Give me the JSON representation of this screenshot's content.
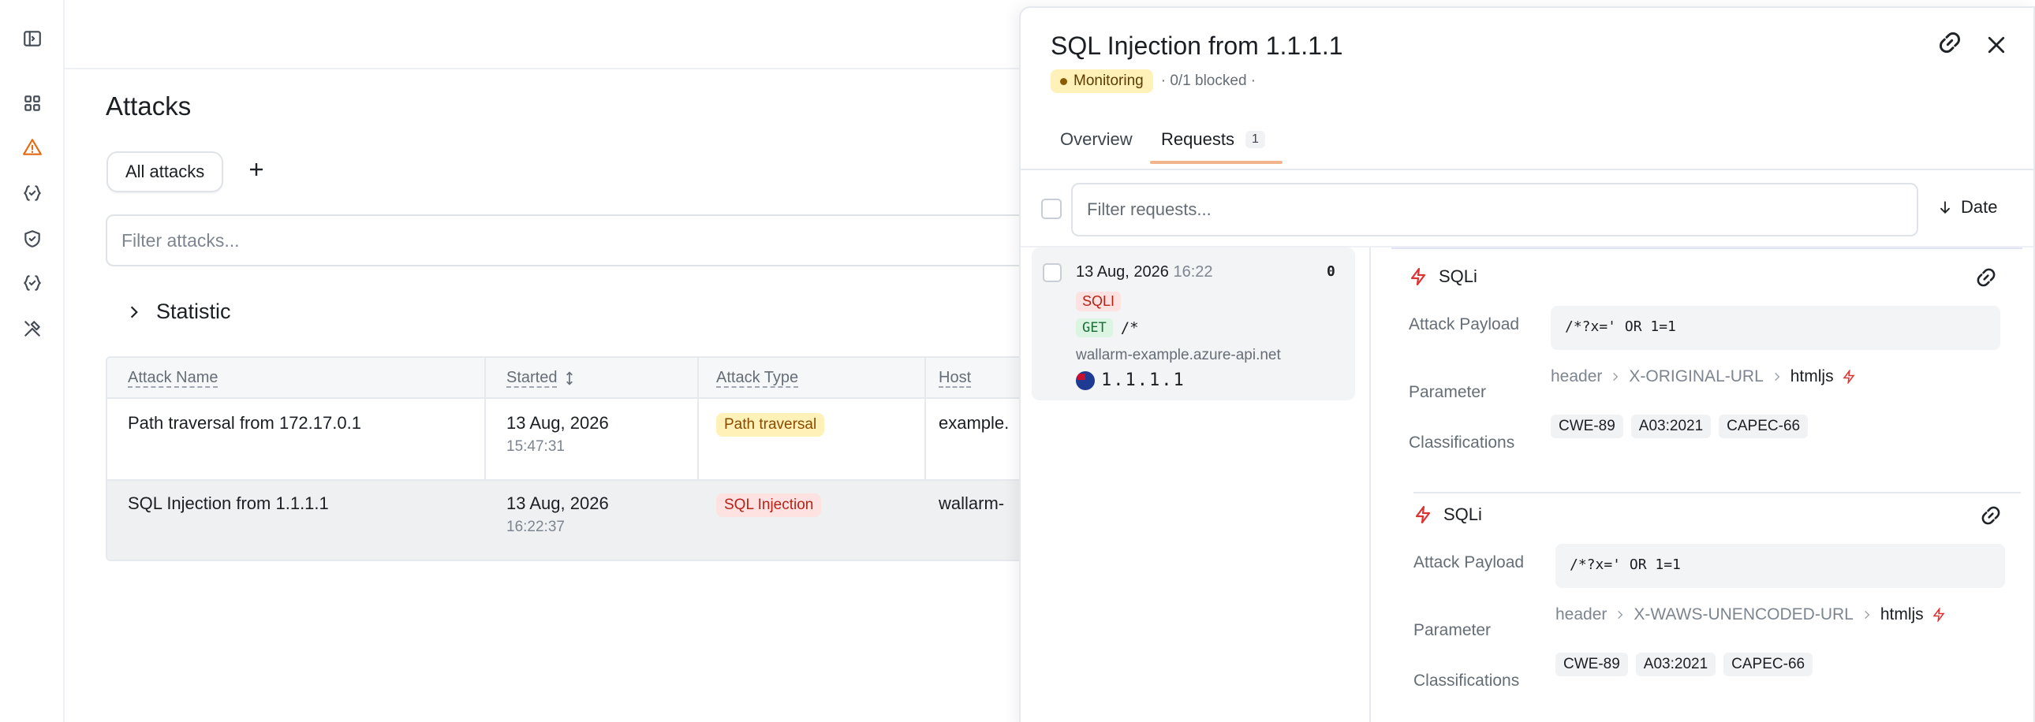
{
  "nav": {
    "icons": [
      "sidebar-toggle-icon",
      "dashboard-icon",
      "attacks-warning-icon",
      "api-braces-icon",
      "shield-icon",
      "api-braces-icon",
      "tools-icon"
    ]
  },
  "page": {
    "title": "Attacks",
    "tab_label": "All attacks",
    "filter_placeholder": "Filter attacks...",
    "statistic_label": "Statistic"
  },
  "table": {
    "columns": [
      "Attack Name",
      "Started",
      "Attack Type",
      "Host"
    ],
    "rows": [
      {
        "name": "Path traversal from 172.17.0.1",
        "date": "13 Aug, 2026",
        "time": "15:47:31",
        "type": "Path traversal",
        "host": "example."
      },
      {
        "name": "SQL Injection from 1.1.1.1",
        "date": "13 Aug, 2026",
        "time": "16:22:37",
        "type": "SQL Injection",
        "host": "wallarm-"
      }
    ]
  },
  "drawer": {
    "title": "SQL Injection from 1.1.1.1",
    "status_badge": "Monitoring",
    "blocked_text": "· 0/1 blocked ·",
    "tabs": {
      "overview": "Overview",
      "requests": "Requests",
      "requests_count": "1"
    },
    "filter_placeholder": "Filter requests...",
    "sort_label": "Date",
    "request": {
      "date": "13 Aug, 2026",
      "time": "16:22",
      "count": "0",
      "tag": "SQLI",
      "method": "GET",
      "path": "/*",
      "host": "wallarm-example.azure-api.net",
      "ip": "1.1.1.1"
    },
    "details": [
      {
        "title": "SQLi",
        "payload_label": "Attack Payload",
        "payload": "/*?x=' OR 1=1",
        "parameter_label": "Parameter",
        "param_path": [
          "header",
          "X-ORIGINAL-URL",
          "htmljs"
        ],
        "classifications_label": "Classifications",
        "classifications": [
          "CWE-89",
          "A03:2021",
          "CAPEC-66"
        ]
      },
      {
        "title": "SQLi",
        "payload_label": "Attack Payload",
        "payload": "/*?x=' OR 1=1",
        "parameter_label": "Parameter",
        "param_path": [
          "header",
          "X-WAWS-UNENCODED-URL",
          "htmljs"
        ],
        "classifications_label": "Classifications",
        "classifications": [
          "CWE-89",
          "A03:2021",
          "CAPEC-66"
        ]
      }
    ]
  },
  "colors": {
    "accent": "#e36a12",
    "danger": "#e03131",
    "monitoring_bg": "#fff1b8"
  }
}
